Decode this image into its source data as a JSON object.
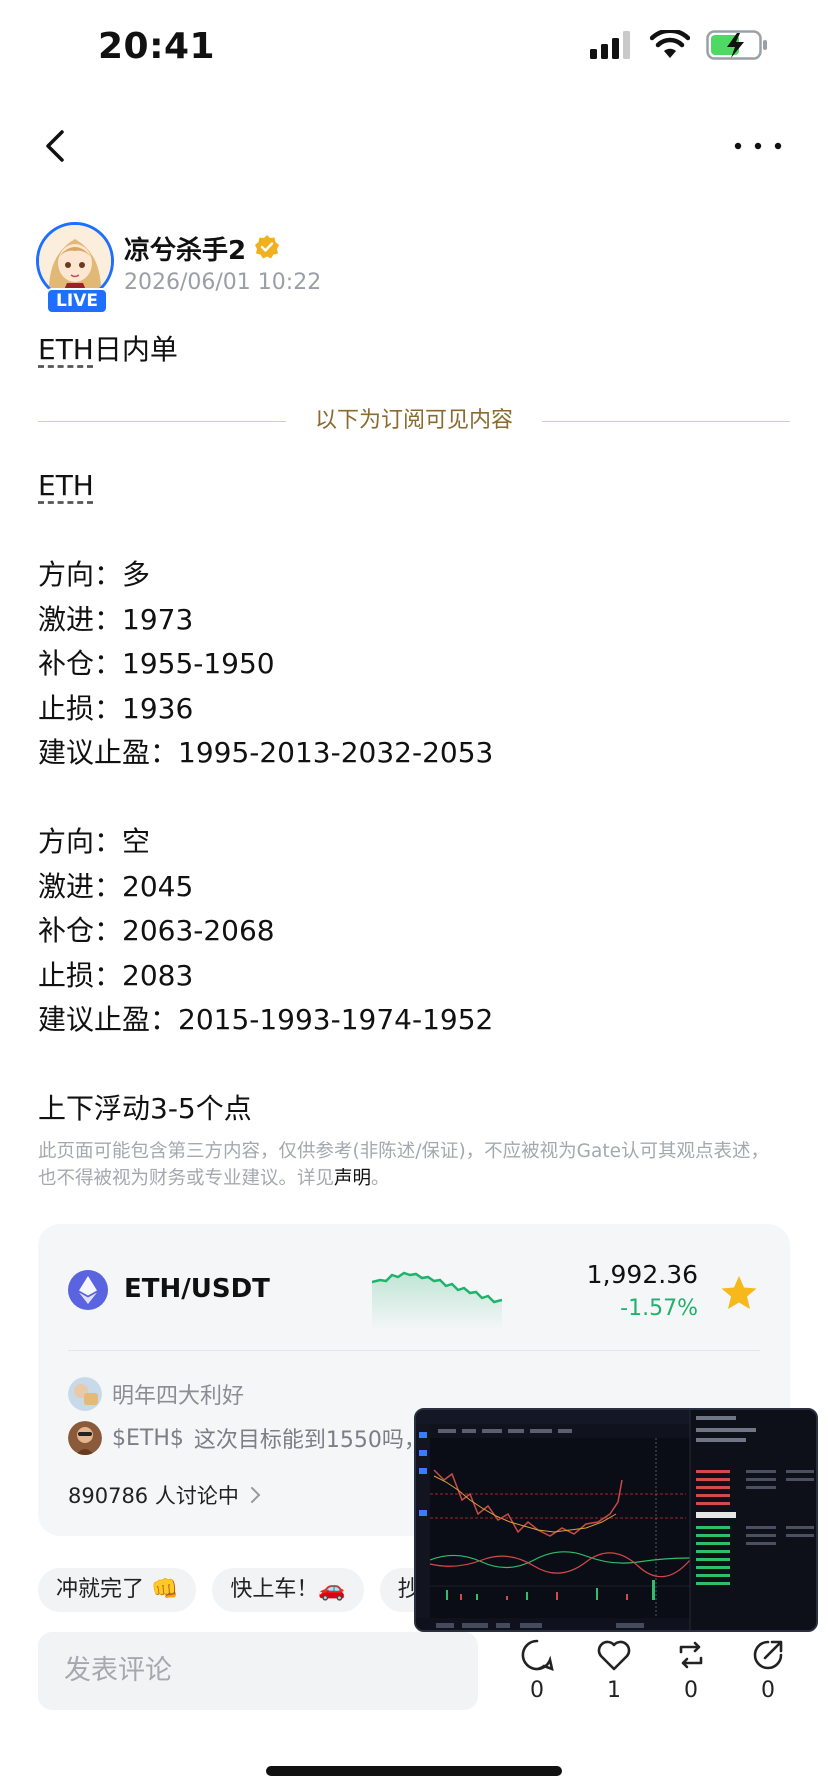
{
  "status_bar": {
    "time": "20:41"
  },
  "author": {
    "name": "凉兮杀手2",
    "post_time": "2026/06/01 10:22",
    "live_badge": "LIVE"
  },
  "post": {
    "title_symbol": "ETH",
    "title_rest": "日内单",
    "divider_text": "以下为订阅可见内容",
    "symbol": "ETH",
    "long_block": {
      "direction": "方向：多",
      "entry": "激进：1973",
      "add": "补仓：1955-1950",
      "stop": "止损：1936",
      "take_profit": "建议止盈：1995-2013-2032-2053"
    },
    "short_block": {
      "direction": "方向：空",
      "entry": "激进：2045",
      "add": "补仓：2063-2068",
      "stop": "止损：2083",
      "take_profit": "建议止盈：2015-1993-1974-1952"
    },
    "note": "上下浮动3-5个点",
    "disclaimer": "此页面可能包含第三方内容，仅供参考(非陈述/保证)，不应被视为Gate认可其观点表述，也不得被视为财务或专业建议。详见",
    "disclaimer_link": "声明",
    "disclaimer_end": "。"
  },
  "market_card": {
    "pair": "ETH/USDT",
    "price": "1,992.36",
    "change": "-1.57%",
    "change_color": "#20b26c",
    "favorite": true,
    "comments": [
      {
        "name": "明年四大利好",
        "text": ""
      },
      {
        "name": "$ETH$",
        "text": "这次目标能到1550吗，拉"
      }
    ],
    "discussion": "890786 人讨论中"
  },
  "quick_replies": [
    "冲就完了 👊",
    "快上车！🚗",
    "抄底"
  ],
  "bottom_bar": {
    "comment_placeholder": "发表评论",
    "comment_count": "0",
    "like_count": "1",
    "repost_count": "0",
    "share_count": "0"
  }
}
